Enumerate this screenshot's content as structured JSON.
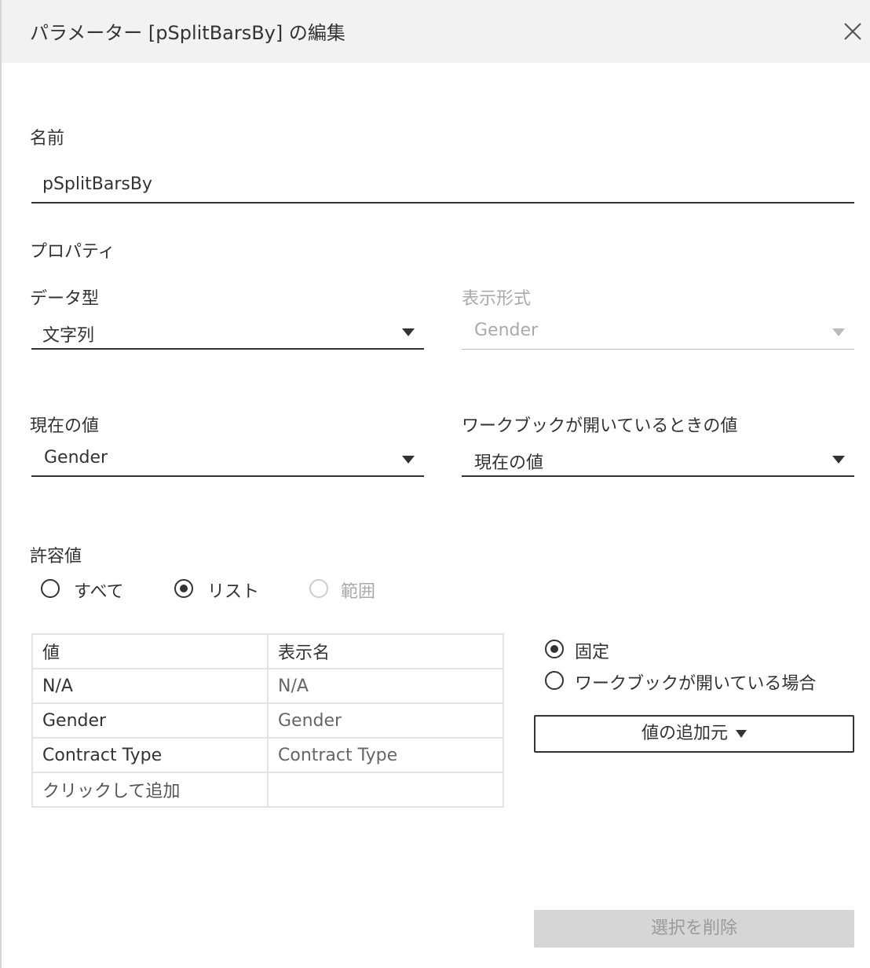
{
  "dialog": {
    "title": "パラメーター [pSplitBarsBy] の編集",
    "close_icon": "close-icon"
  },
  "name": {
    "label": "名前",
    "value": "pSplitBarsBy"
  },
  "properties": {
    "heading": "プロパティ",
    "data_type": {
      "label": "データ型",
      "value": "文字列"
    },
    "display_format": {
      "label": "表示形式",
      "value": "Gender"
    },
    "current_value": {
      "label": "現在の値",
      "value": "Gender"
    },
    "on_open_value": {
      "label": "ワークブックが開いているときの値",
      "value": "現在の値"
    }
  },
  "allowable": {
    "label": "許容値",
    "options": [
      "すべて",
      "リスト",
      "範囲"
    ],
    "selected": "リスト"
  },
  "value_table": {
    "headers": [
      "値",
      "表示名"
    ],
    "rows": [
      [
        "N/A",
        "N/A"
      ],
      [
        "Gender",
        "Gender"
      ],
      [
        "Contract Type",
        "Contract Type"
      ]
    ],
    "add_row_label": "クリックして追加"
  },
  "list_source": {
    "options": [
      "固定",
      "ワークブックが開いている場合"
    ],
    "selected": "固定"
  },
  "buttons": {
    "add_values_from": "値の追加元",
    "remove_selected": "選択を削除"
  }
}
